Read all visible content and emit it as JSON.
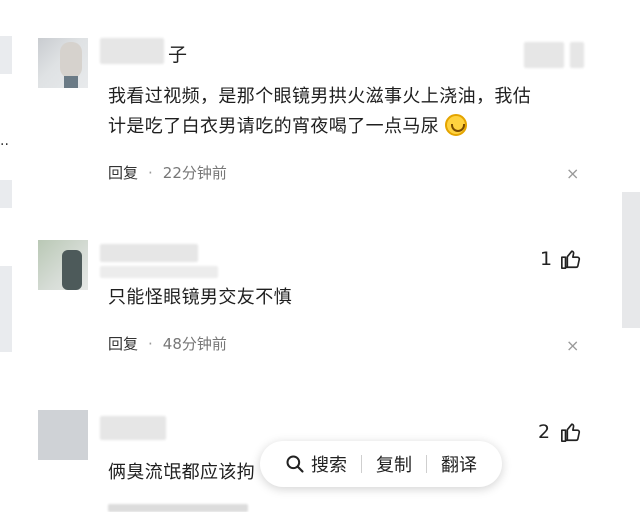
{
  "comments": [
    {
      "name": "子",
      "text_line1": "我看过视频，是那个眼镜男拱火滋事火上浇油，我估",
      "text_line2": "计是吃了白衣男请吃的宵夜喝了一点马尿",
      "emoji": "smile-emoji",
      "reply_label": "回复",
      "separator": "·",
      "time": "22分钟前"
    },
    {
      "text": "只能怪眼镜男交友不慎",
      "like_count": "1",
      "reply_label": "回复",
      "separator": "·",
      "time": "48分钟前"
    },
    {
      "text": "俩臭流氓都应该拘",
      "like_count": "2"
    }
  ],
  "context_menu": {
    "search_label": "搜索",
    "copy_label": "复制",
    "translate_label": "翻译"
  },
  "icons": {
    "like": "thumbs-up-icon",
    "close": "close-icon",
    "search": "search-icon"
  },
  "colors": {
    "meta_text": "#777777",
    "body_text": "#1f1f1f",
    "background": "#ffffff"
  }
}
